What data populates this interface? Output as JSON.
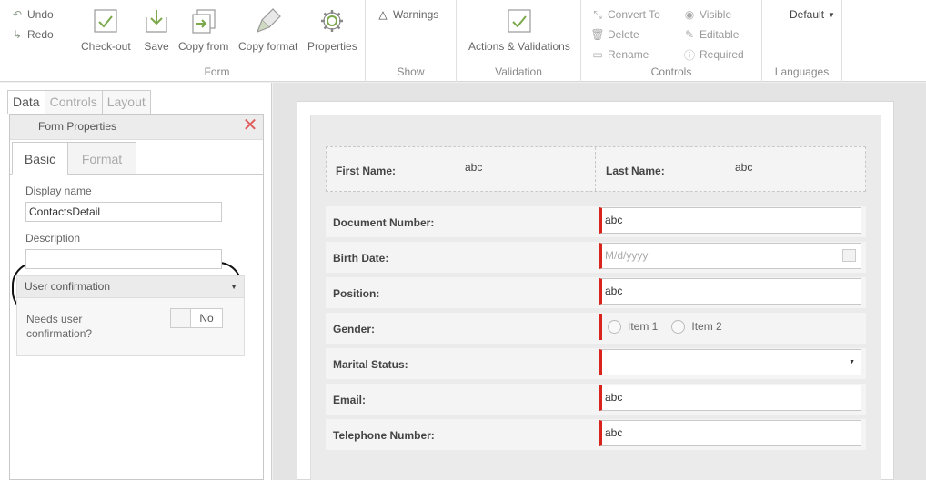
{
  "ribbon": {
    "undo": "Undo",
    "redo": "Redo",
    "form": {
      "label": "Form",
      "checkout": "Check-out",
      "save": "Save",
      "copy_from": "Copy from",
      "copy_format": "Copy format",
      "properties": "Properties"
    },
    "show": {
      "label": "Show",
      "warnings": "Warnings"
    },
    "validation": {
      "label": "Validation",
      "actions": "Actions & Validations"
    },
    "controls": {
      "label": "Controls",
      "convert_to": "Convert To",
      "delete": "Delete",
      "rename": "Rename",
      "visible": "Visible",
      "editable": "Editable",
      "required": "Required"
    },
    "languages": {
      "label": "Languages",
      "selected": "Default"
    }
  },
  "left_tabs": [
    "Data",
    "Controls",
    "Layout"
  ],
  "form_properties": {
    "title": "Form Properties",
    "tabs": [
      "Basic",
      "Format"
    ],
    "display_name_label": "Display name",
    "display_name_value": "ContactsDetail",
    "description_label": "Description",
    "description_value": "",
    "user_confirmation": {
      "header": "User confirmation",
      "needs_label_1": "Needs user",
      "needs_label_2": "confirmation?",
      "toggle_value": "No"
    }
  },
  "form": {
    "first_name_label": "First Name:",
    "first_name_value": "abc",
    "last_name_label": "Last Name:",
    "last_name_value": "abc",
    "rows": [
      {
        "label": "Document Number:",
        "value": "abc"
      },
      {
        "label": "Birth Date:",
        "placeholder": "M/d/yyyy"
      },
      {
        "label": "Position:",
        "value": "abc"
      },
      {
        "label": "Gender:",
        "options": [
          "Item 1",
          "Item 2"
        ]
      },
      {
        "label": "Marital Status:",
        "value": ""
      },
      {
        "label": "Email:",
        "value": "abc"
      },
      {
        "label": "Telephone Number:",
        "value": "abc"
      }
    ]
  },
  "colors": {
    "required_marker": "#d9241e",
    "close_icon": "#e05a5a",
    "icon_green": "#7aa84a"
  }
}
